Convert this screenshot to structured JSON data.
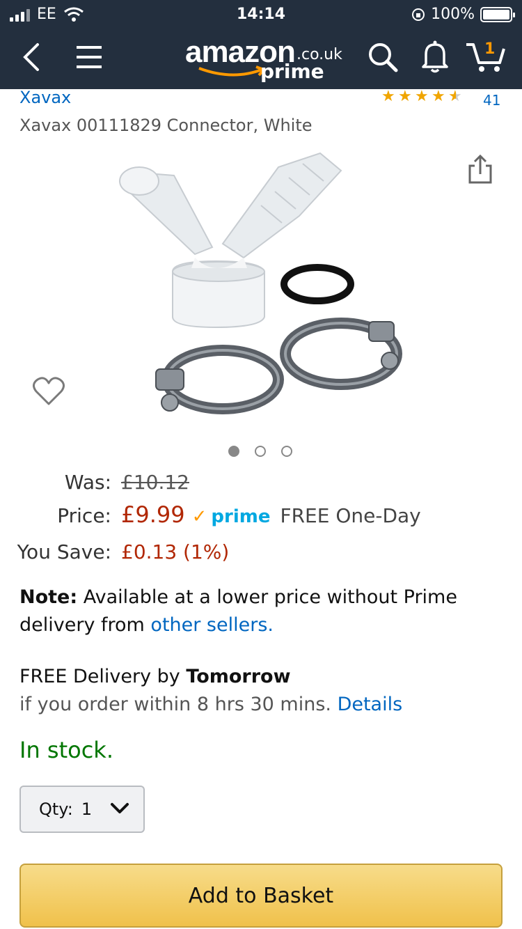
{
  "status_bar": {
    "carrier": "EE",
    "time": "14:14",
    "battery": "100%"
  },
  "nav": {
    "logo_word": "amazon",
    "logo_tld": ".co.uk",
    "logo_prime": "prime",
    "cart_count": "1",
    "icons": [
      "back-icon",
      "menu-icon",
      "search-icon",
      "bell-icon",
      "cart-icon"
    ]
  },
  "product": {
    "brand": "Xavax",
    "rating_stars": 4.5,
    "review_count": "41",
    "title": "Xavax 00111829 Connector, White",
    "image_count": 3,
    "active_image": 1
  },
  "pricing": {
    "was_label": "Was:",
    "was_value": "£10.12",
    "price_label": "Price:",
    "price_value": "£9.99",
    "prime_label": "prime",
    "shipping": "FREE One-Day",
    "save_label": "You Save:",
    "save_value": "£0.13 (1%)"
  },
  "note": {
    "bold": "Note:",
    "text": " Available at a lower price without Prime delivery from ",
    "link": "other sellers."
  },
  "delivery": {
    "line1": "FREE Delivery by ",
    "day": "Tomorrow",
    "line2": "if you order within 8 hrs 30 mins. ",
    "details_link": "Details"
  },
  "availability": "In stock.",
  "quantity": {
    "label": "Qty:",
    "value": "1"
  },
  "add_to_basket": "Add to Basket",
  "colors": {
    "header_bg": "#232f3e",
    "price_red": "#b12704",
    "link_blue": "#0066c0",
    "stock_green": "#007600",
    "amazon_orange": "#ff9900",
    "button_yellow": "#f0c14b"
  }
}
